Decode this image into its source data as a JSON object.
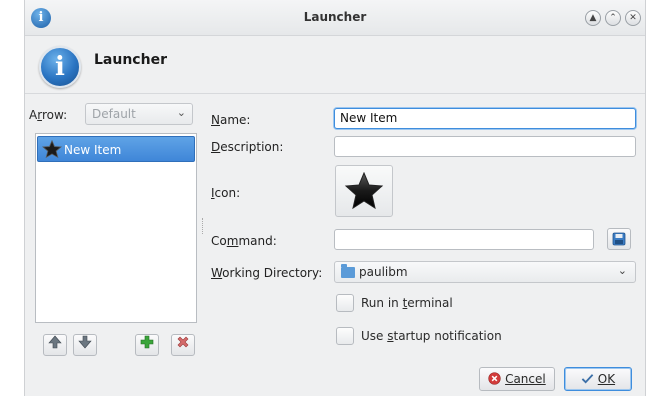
{
  "window": {
    "title": "Launcher",
    "header_title": "Launcher"
  },
  "left_panel": {
    "arrow_label": "Arrow:",
    "arrow_value": "Default",
    "items": [
      {
        "label": "New Item",
        "selected": true
      }
    ]
  },
  "form": {
    "name_label": "Name:",
    "name_value": "New Item",
    "description_label": "Description:",
    "description_value": "",
    "icon_label": "Icon:",
    "command_label": "Command:",
    "command_value": "",
    "working_dir_label": "Working Directory:",
    "working_dir_value": "paulibm",
    "run_in_terminal_label": "Run in terminal",
    "run_in_terminal_checked": false,
    "startup_notification_label": "Use startup notification",
    "startup_notification_checked": false
  },
  "buttons": {
    "cancel": "Cancel",
    "ok": "OK"
  },
  "colors": {
    "selection": "#3f86d8",
    "focus": "#3e8ddd",
    "window_bg": "#eff0f1"
  },
  "icons": [
    "info-icon",
    "star-icon",
    "arrow-up-icon",
    "arrow-down-icon",
    "add-icon",
    "remove-icon",
    "save-icon",
    "folder-icon",
    "cancel-icon",
    "ok-icon"
  ]
}
